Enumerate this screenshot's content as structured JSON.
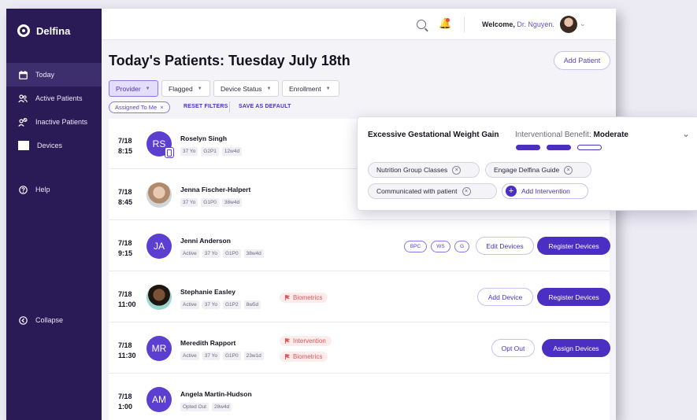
{
  "app": {
    "name": "Delfina"
  },
  "sidebar": {
    "items": [
      {
        "label": "Today",
        "icon": "calendar-icon"
      },
      {
        "label": "Active Patients",
        "icon": "users-icon"
      },
      {
        "label": "Inactive Patients",
        "icon": "users-off-icon"
      },
      {
        "label": "Devices",
        "icon": "device-square-icon"
      },
      {
        "label": "Help",
        "icon": "help-circle-icon"
      },
      {
        "label": "Collapse",
        "icon": "collapse-icon"
      }
    ]
  },
  "topbar": {
    "welcome": "Welcome,",
    "doctor": "Dr. Nguyen."
  },
  "page": {
    "title": "Today's Patients: Tuesday July 18th",
    "add_patient": "Add Patient"
  },
  "filters": {
    "provider": "Provider",
    "flagged": "Flagged",
    "device_status": "Device Status",
    "enrollment": "Enrollment",
    "assigned_chip": "Assigned To Me",
    "reset": "RESET FILTERS",
    "save_default": "SAVE AS DEFAULT"
  },
  "patients": [
    {
      "date": "7/18",
      "time": "8:15",
      "initials": "RS",
      "name": "Roselyn Singh",
      "tags": [
        "37 Yo",
        "G2P1",
        "12w4d"
      ]
    },
    {
      "date": "7/18",
      "time": "8:45",
      "initials": "",
      "name": "Jenna Fischer-Halpert",
      "tags": [
        "37 Yo",
        "G1P0",
        "38w4d"
      ]
    },
    {
      "date": "7/18",
      "time": "9:15",
      "initials": "JA",
      "name": "Jenni Anderson",
      "tags": [
        "Active",
        "37 Yo",
        "G1P0",
        "38w4d"
      ],
      "devices": [
        "BPC",
        "WS",
        "G"
      ],
      "actions": [
        "Edit Devices",
        "Register Devices"
      ]
    },
    {
      "date": "7/18",
      "time": "11:00",
      "initials": "",
      "name": "Stephanie Easley",
      "tags": [
        "Active",
        "37 Yo",
        "G1P2",
        "8w5d"
      ],
      "flags": [
        "Biometrics"
      ],
      "actions": [
        "Add Device",
        "Register Devices"
      ]
    },
    {
      "date": "7/18",
      "time": "11:30",
      "initials": "MR",
      "name": "Meredith Rapport",
      "tags": [
        "Active",
        "37 Yo",
        "G1P0",
        "23w1d"
      ],
      "flags": [
        "Intervention",
        "Biometrics"
      ],
      "actions": [
        "Opt Out",
        "Assign Devices"
      ]
    },
    {
      "date": "7/18",
      "time": "1:00",
      "initials": "AM",
      "name": "Angela Martin-Hudson",
      "tags": [
        "Opted Out",
        "28w4d"
      ]
    }
  ],
  "popup": {
    "title": "Excessive Gestational Weight Gain",
    "benefit_label": "Interventional Benefit:",
    "benefit_value": "Moderate",
    "benefit_level": 2,
    "benefit_max": 3,
    "chips": [
      "Nutrition Group Classes",
      "Engage Delfina Guide",
      "Communicated with patient"
    ],
    "add_label": "Add Intervention"
  }
}
